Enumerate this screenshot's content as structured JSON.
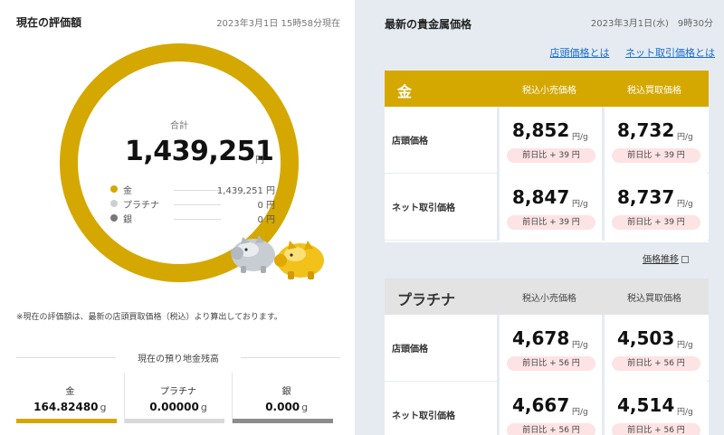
{
  "left": {
    "title": "現在の評価額",
    "date": "2023年3月1日 15時58分現在",
    "total_label": "合計",
    "total_value": "1,439,251",
    "total_unit": "円",
    "breakdown": [
      {
        "name": "金",
        "value": "1,439,251 円",
        "color": "#d4a800"
      },
      {
        "name": "プラチナ",
        "value": "0 円",
        "color": "#cfcfcf"
      },
      {
        "name": "銀",
        "value": "0 円",
        "color": "#777777"
      }
    ],
    "note": "※現在の評価額は、最新の店頭買取価格（税込）より算出しております。",
    "holdings_title": "現在の預り地金残高",
    "holdings": [
      {
        "name": "金",
        "value": "164.82480",
        "unit": "g",
        "bar_color": "#d4a800"
      },
      {
        "name": "プラチナ",
        "value": "0.00000",
        "unit": "g",
        "bar_color": "#d9d9d9"
      },
      {
        "name": "銀",
        "value": "0.000",
        "unit": "g",
        "bar_color": "#8c8c8c"
      }
    ]
  },
  "right": {
    "title": "最新の貴金属価格",
    "date": "2023年3月1日(水)　9時30分",
    "links": [
      "店頭価格とは",
      "ネット取引価格とは"
    ],
    "price_col_retail": "税込小売価格",
    "price_col_buy": "税込買取価格",
    "row_store": "店頭価格",
    "row_net": "ネット取引価格",
    "unit": "円/g",
    "chart_link": "価格推移",
    "gold": {
      "name": "金",
      "store_retail": "8,852",
      "store_retail_diff": "前日比 + 39 円",
      "store_buy": "8,732",
      "store_buy_diff": "前日比 + 39 円",
      "net_retail": "8,847",
      "net_retail_diff": "前日比 + 39 円",
      "net_buy": "8,737",
      "net_buy_diff": "前日比 + 39 円"
    },
    "platinum": {
      "name": "プラチナ",
      "store_retail": "4,678",
      "store_retail_diff": "前日比 + 56 円",
      "store_buy": "4,503",
      "store_buy_diff": "前日比 + 56 円",
      "net_retail": "4,667",
      "net_retail_diff": "前日比 + 56 円",
      "net_buy": "4,514",
      "net_buy_diff": "前日比 + 56 円"
    }
  }
}
